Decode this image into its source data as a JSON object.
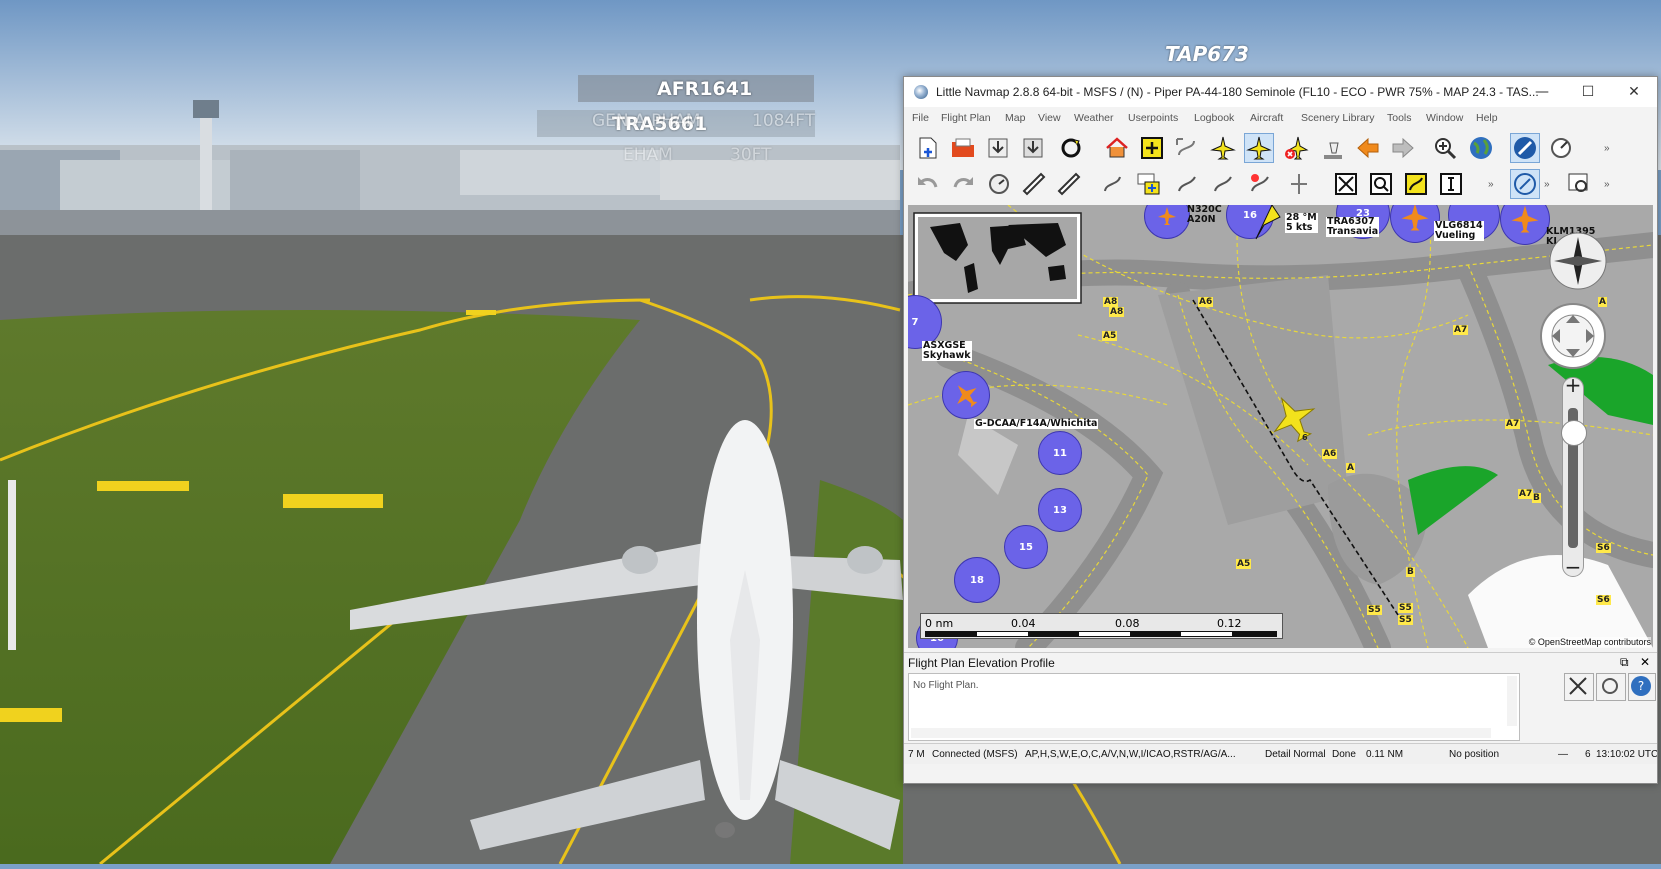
{
  "scene": {
    "labels": [
      {
        "text": "TAP673"
      },
      {
        "text": "AFR1641"
      },
      {
        "text": "TRA5661"
      },
      {
        "text": "GEN A PHAM"
      },
      {
        "text": "1084FT"
      },
      {
        "text": "EHAM"
      },
      {
        "text": "30FT"
      }
    ]
  },
  "window": {
    "title": "Little Navmap 2.8.8 64-bit - MSFS / (N) - Piper PA-44-180 Seminole (FL10 - ECO - PWR 75% - MAP 24.3 - TAS...",
    "controls": {
      "minimize": "—",
      "maximize": "☐",
      "close": "✕"
    },
    "menu": [
      "File",
      "Flight Plan",
      "Map",
      "View",
      "Weather",
      "Userpoints",
      "Logbook",
      "Aircraft",
      "Scenery Library",
      "Tools",
      "Window",
      "Help"
    ],
    "more": "»"
  },
  "map": {
    "aircraft_labels": [
      {
        "line1": "N320C",
        "line2": "A20N"
      },
      {
        "line1": "28 °M",
        "line2": "5 kts"
      },
      {
        "line1": "TRA6307",
        "line2": "Transavia"
      },
      {
        "line1": "VLG6814",
        "line2": "Vueling"
      },
      {
        "line1": "KLM1395",
        "line2": "KL"
      },
      {
        "line1": "ASXGSE",
        "line2": "Skyhawk"
      },
      {
        "line1": "G-DCAA/F14A/Whichita",
        "line2": ""
      }
    ],
    "clusters": [
      "16",
      "23",
      "11",
      "13",
      "15",
      "18",
      "16"
    ],
    "cluster7": "7",
    "taxiways": [
      "A6",
      "A8",
      "A8",
      "A5",
      "A7",
      "A7",
      "A6",
      "A",
      "A7",
      "B",
      "A5",
      "B",
      "S5",
      "S5",
      "S6",
      "S6",
      "S",
      "A",
      "6",
      "B"
    ],
    "scale": {
      "labels": [
        "0 nm",
        "0.04",
        "0.08",
        "0.12"
      ]
    },
    "attribution": "© OpenStreetMap contributors"
  },
  "profile": {
    "title": "Flight Plan Elevation Profile",
    "message": "No Flight Plan."
  },
  "status": {
    "messages": "7 M",
    "connection": "Connected (MSFS)",
    "filters": "AP,H,S,W,E,O,C,A/V,N,W,I/ICAO,RSTR/AG/A...",
    "detail": "Detail Normal",
    "done": "Done",
    "distance": "0.11 NM",
    "position": "No position",
    "dash": "—",
    "count": "6",
    "time": "13:10:02 UTC"
  },
  "colors": {
    "accent": "#ffe94a",
    "cluster": "#6b63e8",
    "aircraft": "#f08a1c",
    "user_aircraft": "#f3e21c"
  }
}
